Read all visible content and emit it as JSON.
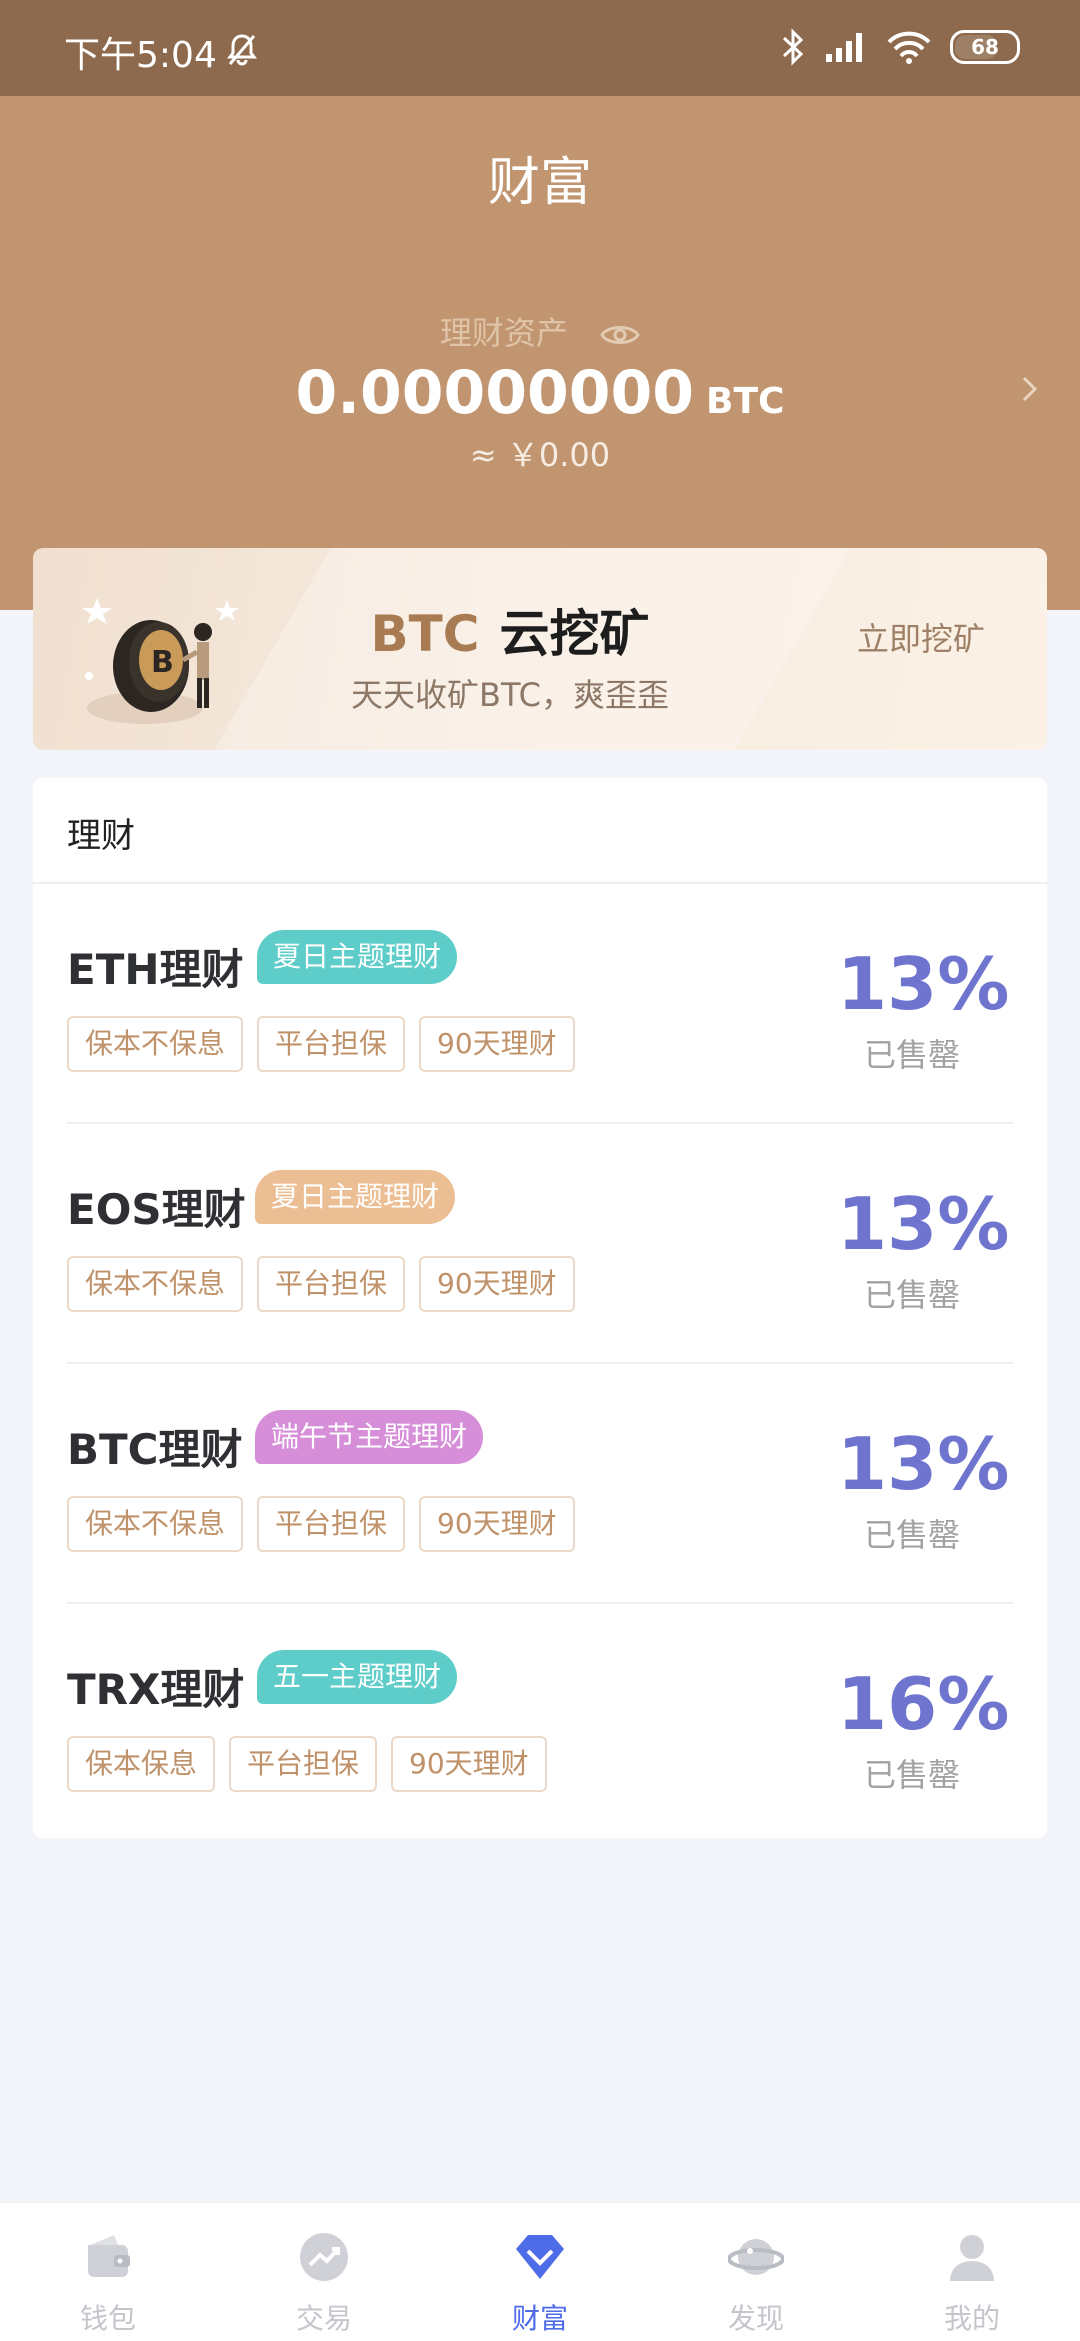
{
  "status_bar": {
    "time": "下午5:04",
    "battery": "68"
  },
  "header": {
    "title": "财富",
    "asset_label": "理财资产",
    "asset_amount": "0.00000000",
    "asset_unit": "BTC",
    "asset_fiat": "≈ ￥0.00"
  },
  "banner": {
    "title_btc": "BTC",
    "title_rest": "云挖矿",
    "subtitle": "天天收矿BTC，爽歪歪",
    "cta": "立即挖矿"
  },
  "list": {
    "title": "理财",
    "items": [
      {
        "name": "ETH理财",
        "tag": "夏日主题理财",
        "tag_color": "#5ecdc9",
        "chips": [
          "保本不保息",
          "平台担保",
          "90天理财"
        ],
        "percent": "13%",
        "status": "已售罄"
      },
      {
        "name": "EOS理财",
        "tag": "夏日主题理财",
        "tag_color": "#ecbe93",
        "chips": [
          "保本不保息",
          "平台担保",
          "90天理财"
        ],
        "percent": "13%",
        "status": "已售罄"
      },
      {
        "name": "BTC理财",
        "tag": "端午节主题理财",
        "tag_color": "#d68ed8",
        "chips": [
          "保本不保息",
          "平台担保",
          "90天理财"
        ],
        "percent": "13%",
        "status": "已售罄"
      },
      {
        "name": "TRX理财",
        "tag": "五一主题理财",
        "tag_color": "#5ecdc9",
        "chips": [
          "保本保息",
          "平台担保",
          "90天理财"
        ],
        "percent": "16%",
        "status": "已售罄"
      }
    ]
  },
  "tabbar": {
    "tabs": [
      {
        "label": "钱包",
        "icon": "wallet-icon"
      },
      {
        "label": "交易",
        "icon": "trade-chart-icon"
      },
      {
        "label": "财富",
        "icon": "wealth-diamond-icon",
        "active": true
      },
      {
        "label": "发现",
        "icon": "planet-icon"
      },
      {
        "label": "我的",
        "icon": "profile-icon"
      }
    ]
  },
  "colors": {
    "status_bar": "#8d6a4d",
    "header": "#c09570",
    "accent": "#4e6ce8",
    "percent": "#6f74cf"
  }
}
